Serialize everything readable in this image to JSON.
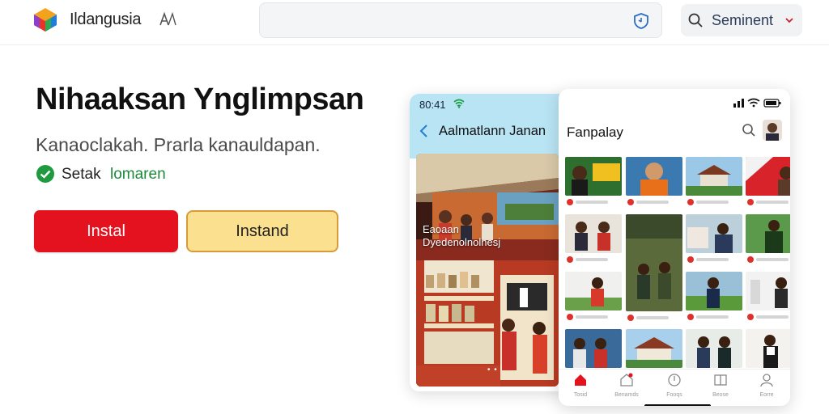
{
  "header": {
    "brand": "Ildangusia",
    "search": {
      "value": "",
      "placeholder": ""
    },
    "sentiment_label": "Seminent",
    "icons": [
      "app-logo-icon",
      "translate-icon",
      "shield-icon",
      "search-icon",
      "chevron-down-icon"
    ]
  },
  "hero": {
    "title": "Nihaaksan Ynglimpsan",
    "subtitle": "Kanaoclakah. Prarla kanauldapan.",
    "check_label": "Setak",
    "check_value": "lomaren",
    "buttons": {
      "primary": "Instal",
      "secondary": "Instand"
    }
  },
  "phone1": {
    "time": "80:41",
    "title": "Aalmatlann Janan",
    "overlay_line1": "Eaoaan",
    "overlay_line2": "Dyedenolnolnesj",
    "dots": "• •"
  },
  "phone2": {
    "title": "Fanpalay",
    "tabs": [
      {
        "label": "Tosid",
        "icon": "home-icon"
      },
      {
        "label": "Benamds",
        "icon": "store-icon"
      },
      {
        "label": "Fooqs",
        "icon": "compass-icon"
      },
      {
        "label": "Beose",
        "icon": "book-icon"
      },
      {
        "label": "Eorre",
        "icon": "profile-icon"
      }
    ]
  },
  "colors": {
    "primary_red": "#e4111f",
    "secondary_yellow": "#fbe08f",
    "secondary_border": "#d99a3a",
    "check_green": "#1c8a3a",
    "phone_header_blue": "#b9e4f4"
  }
}
